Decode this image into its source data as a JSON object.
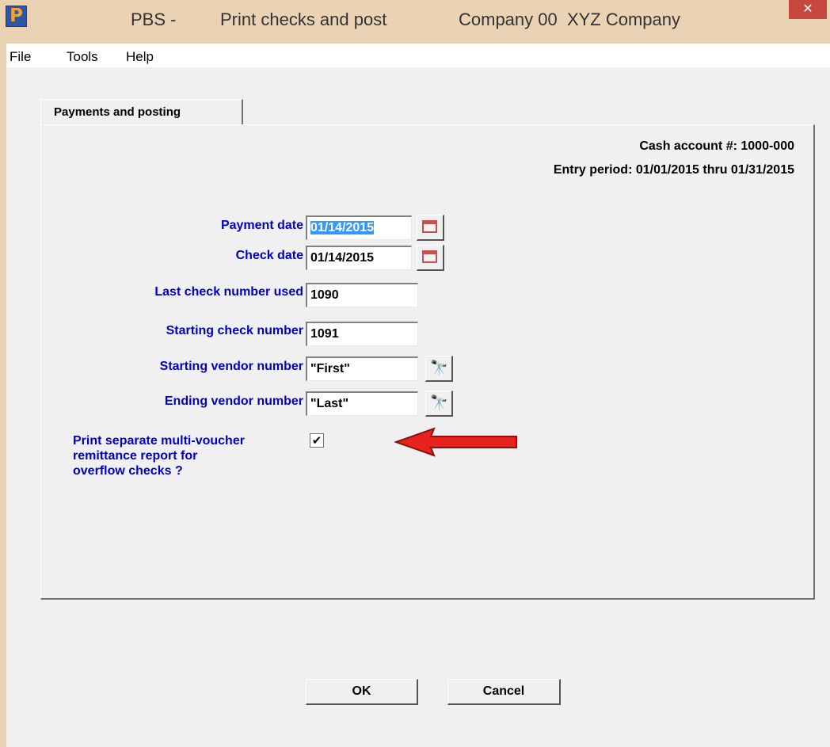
{
  "window": {
    "logo_letter": "P",
    "title_app": "PBS -",
    "title_function": "Print checks and post",
    "title_company": "Company 00  XYZ Company",
    "close_symbol": "✕"
  },
  "menu": {
    "items": [
      "File",
      "Tools",
      "Help"
    ]
  },
  "tab": {
    "label": "Payments and posting"
  },
  "info": {
    "cash_account": "Cash account #: 1000-000",
    "entry_period": "Entry period: 01/01/2015 thru 01/31/2015"
  },
  "fields": {
    "payment_date": {
      "label": "Payment date",
      "value": "01/14/2015"
    },
    "check_date": {
      "label": "Check date",
      "value": "01/14/2015"
    },
    "last_check_number": {
      "label": "Last check number used",
      "value": "1090"
    },
    "starting_check_number": {
      "label": "Starting check number",
      "value": "1091"
    },
    "starting_vendor": {
      "label": "Starting vendor number",
      "value": "\"First\""
    },
    "ending_vendor": {
      "label": "Ending vendor number",
      "value": "\"Last\""
    }
  },
  "multi_voucher": {
    "label_line1": "Print separate multi-voucher",
    "label_line2": "remittance report for",
    "label_line3": "overflow checks ?",
    "checked": true,
    "check_mark": "✔"
  },
  "buttons": {
    "ok_label": "OK",
    "cancel_label": "Cancel"
  },
  "icons": {
    "calendar": "calendar-icon",
    "lookup": "binoculars-icon"
  },
  "colors": {
    "title_bar": "#ead2b4",
    "label_blue": "#0000c8",
    "close_red": "#c7473f",
    "arrow_red": "#e8231f",
    "selection": "#3399ff"
  }
}
